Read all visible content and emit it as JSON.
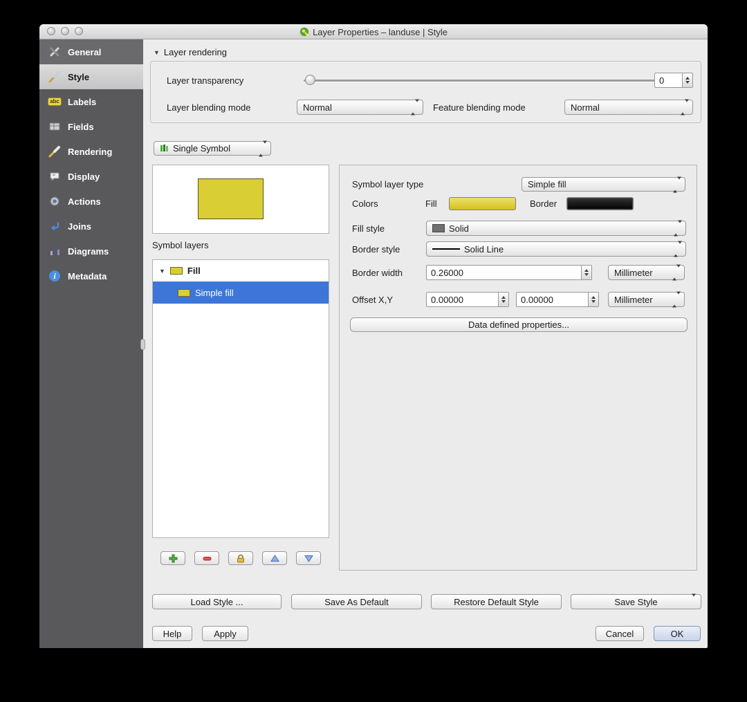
{
  "window": {
    "title": "Layer Properties – landuse | Style"
  },
  "sidebar": {
    "items": [
      {
        "label": "General",
        "icon": "tools-icon"
      },
      {
        "label": "Style",
        "icon": "paintbrush-icon"
      },
      {
        "label": "Labels",
        "icon": "abc-icon"
      },
      {
        "label": "Fields",
        "icon": "table-icon"
      },
      {
        "label": "Rendering",
        "icon": "brush-icon"
      },
      {
        "label": "Display",
        "icon": "speech-bubble-icon"
      },
      {
        "label": "Actions",
        "icon": "gear-action-icon"
      },
      {
        "label": "Joins",
        "icon": "join-arrow-icon"
      },
      {
        "label": "Diagrams",
        "icon": "bar-chart-icon"
      },
      {
        "label": "Metadata",
        "icon": "info-icon"
      }
    ]
  },
  "layer_rendering": {
    "header": "Layer rendering",
    "transparency_label": "Layer transparency",
    "transparency_value": "0",
    "blending_mode_label": "Layer blending mode",
    "blending_mode_value": "Normal",
    "feature_blending_label": "Feature blending mode",
    "feature_blending_value": "Normal"
  },
  "symbol_selector": {
    "value": "Single Symbol"
  },
  "symbol_layers": {
    "label": "Symbol layers",
    "root_item": "Fill",
    "child_item": "Simple fill"
  },
  "symbol_properties": {
    "type_label": "Symbol layer type",
    "type_value": "Simple fill",
    "colors_label": "Colors",
    "fill_label": "Fill",
    "border_label": "Border",
    "fill_style_label": "Fill style",
    "fill_style_value": "Solid",
    "border_style_label": "Border style",
    "border_style_value": "Solid Line",
    "border_width_label": "Border width",
    "border_width_value": "0.26000",
    "border_width_unit": "Millimeter",
    "offset_label": "Offset X,Y",
    "offset_x": "0.00000",
    "offset_y": "0.00000",
    "offset_unit": "Millimeter",
    "data_defined_button": "Data defined properties..."
  },
  "style_actions": {
    "load": "Load Style ...",
    "save_as_default": "Save As Default",
    "restore_default": "Restore Default Style",
    "save_style": "Save Style"
  },
  "dialog_actions": {
    "help": "Help",
    "apply": "Apply",
    "cancel": "Cancel",
    "ok": "OK"
  },
  "colors": {
    "symbol_fill": "#d9ce34",
    "symbol_border": "#000000",
    "selection": "#3d76d8",
    "sidebar_bg": "#59595b"
  }
}
